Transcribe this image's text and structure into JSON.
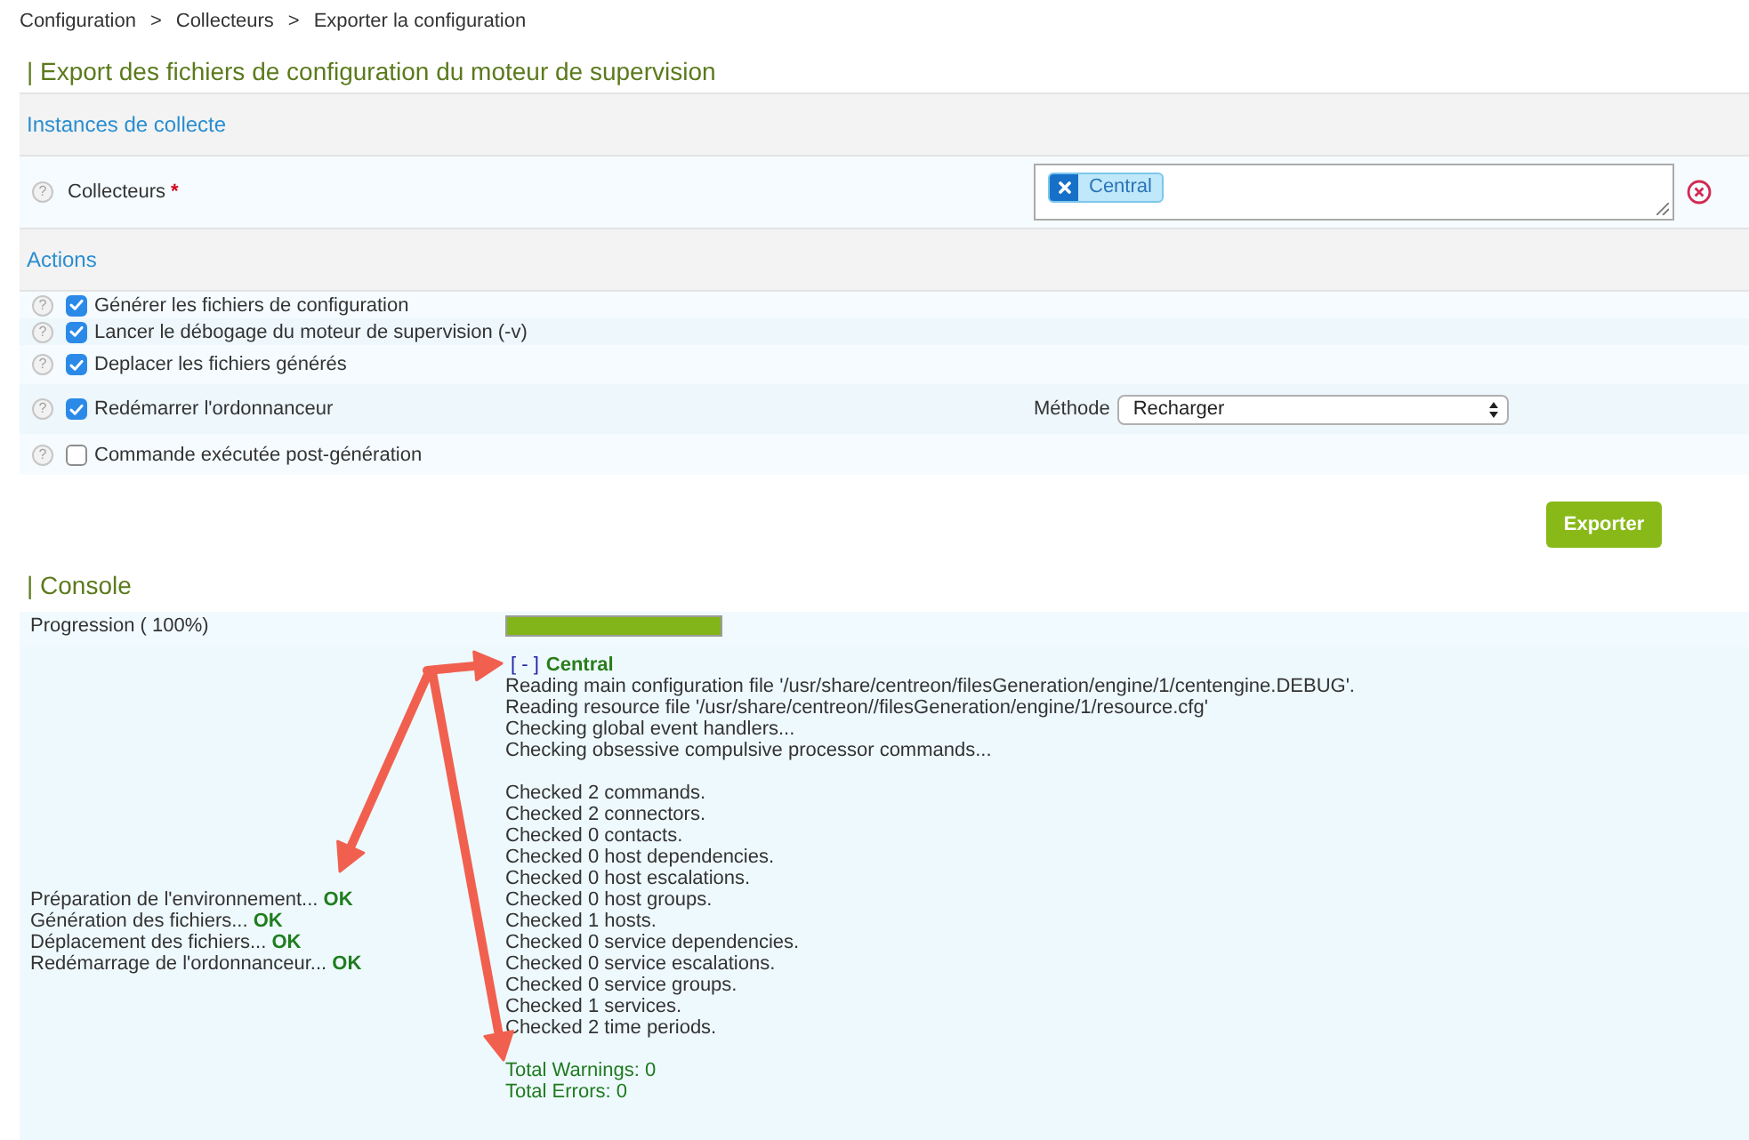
{
  "breadcrumb": [
    {
      "label": "Configuration",
      "separator": ">"
    },
    {
      "label": "Collecteurs",
      "separator": ">"
    },
    {
      "label": "Exporter la configuration"
    }
  ],
  "title": "| Export des fichiers de configuration du moteur de supervision",
  "instances": {
    "header": "Instances de collecte",
    "field": {
      "help": "?",
      "label": "Collecteurs",
      "required_mark": "*",
      "tags": [
        {
          "label": "Central"
        }
      ]
    }
  },
  "actions": {
    "header": "Actions",
    "rows": [
      {
        "help": "?",
        "label": "Générer les fichiers de configuration",
        "checked": true
      },
      {
        "help": "?",
        "label": "Lancer le débogage du moteur de supervision (-v)",
        "checked": true
      },
      {
        "help": "?",
        "label": "Deplacer les fichiers générés",
        "checked": true
      },
      {
        "help": "?",
        "label": "Redémarrer l'ordonnanceur",
        "checked": true,
        "option": {
          "label": "Méthode",
          "value": "Recharger"
        }
      },
      {
        "help": "?",
        "label": "Commande exécutée post-génération",
        "checked": false
      }
    ]
  },
  "export_button": "Exporter",
  "console": {
    "title": "| Console",
    "progress": {
      "label": "Progression ( 100%)",
      "level": 1
    },
    "steps": [
      {
        "label": "Préparation de l'environnement...",
        "result": "OK"
      },
      {
        "label": "Génération des fichiers...",
        "result": "OK"
      },
      {
        "label": "Déplacement des fichiers...",
        "result": "OK"
      },
      {
        "label": "Redémarrage de l'ordonnanceur...",
        "result": "OK"
      }
    ],
    "output": {
      "toggle": "[ - ]",
      "instance": "Central",
      "groups": [
        {
          "kind": "log",
          "lines": [
            "Reading main configuration file '/usr/share/centreon/filesGeneration/engine/1/centengine.DEBUG'.",
            "Reading resource file '/usr/share/centreon//filesGeneration/engine/1/resource.cfg'",
            "Checking global event handlers...",
            "Checking obsessive compulsive processor commands..."
          ]
        },
        {
          "kind": "log",
          "lines": [
            "Checked 2 commands.",
            "Checked 2 connectors.",
            "Checked 0 contacts.",
            "Checked 0 host dependencies.",
            "Checked 0 host escalations.",
            "Checked 0 host groups.",
            "Checked 1 hosts.",
            "Checked 0 service dependencies.",
            "Checked 0 service escalations.",
            "Checked 0 service groups.",
            "Checked 1 services.",
            "Checked 2 time periods."
          ]
        },
        {
          "kind": "summary",
          "lines": [
            "Total Warnings: 0",
            "Total Errors: 0"
          ]
        }
      ]
    }
  }
}
